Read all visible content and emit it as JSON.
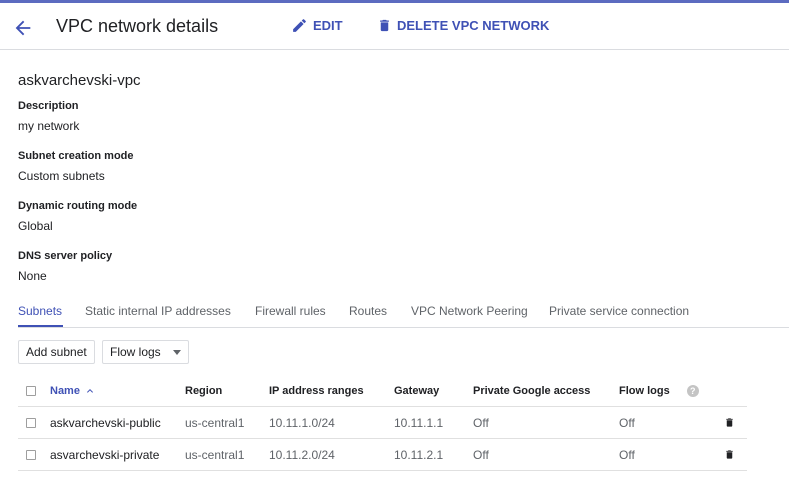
{
  "header": {
    "title": "VPC network details",
    "edit_label": "EDIT",
    "delete_label": "DELETE VPC NETWORK",
    "accent_color": "#3f51b5"
  },
  "network": {
    "name": "askvarchevski-vpc",
    "properties": [
      {
        "label": "Description",
        "value": "my network"
      },
      {
        "label": "Subnet creation mode",
        "value": "Custom subnets"
      },
      {
        "label": "Dynamic routing mode",
        "value": "Global"
      },
      {
        "label": "DNS server policy",
        "value": "None"
      }
    ]
  },
  "tabs": [
    {
      "label": "Subnets",
      "active": true
    },
    {
      "label": "Static internal IP addresses"
    },
    {
      "label": "Firewall rules"
    },
    {
      "label": "Routes"
    },
    {
      "label": "VPC Network Peering"
    },
    {
      "label": "Private service connection"
    }
  ],
  "toolbar": {
    "add_subnet_label": "Add subnet",
    "flow_logs_label": "Flow logs"
  },
  "table": {
    "columns": {
      "name": "Name",
      "region": "Region",
      "ip_ranges": "IP address ranges",
      "gateway": "Gateway",
      "private_google_access": "Private Google access",
      "flow_logs": "Flow logs"
    },
    "help_glyph": "?",
    "rows": [
      {
        "name": "askvarchevski-public",
        "region": "us-central1",
        "ip_range": "10.11.1.0/24",
        "gateway": "10.11.1.1",
        "private_google_access": "Off",
        "flow_logs": "Off"
      },
      {
        "name": "asvarchevski-private",
        "region": "us-central1",
        "ip_range": "10.11.2.0/24",
        "gateway": "10.11.2.1",
        "private_google_access": "Off",
        "flow_logs": "Off"
      }
    ]
  },
  "icons": {
    "back": "arrow-back-icon",
    "edit": "pencil-icon",
    "delete": "trash-icon",
    "sort": "sort-ascending-icon",
    "help": "help-icon",
    "dropdown": "caret-down-icon"
  }
}
